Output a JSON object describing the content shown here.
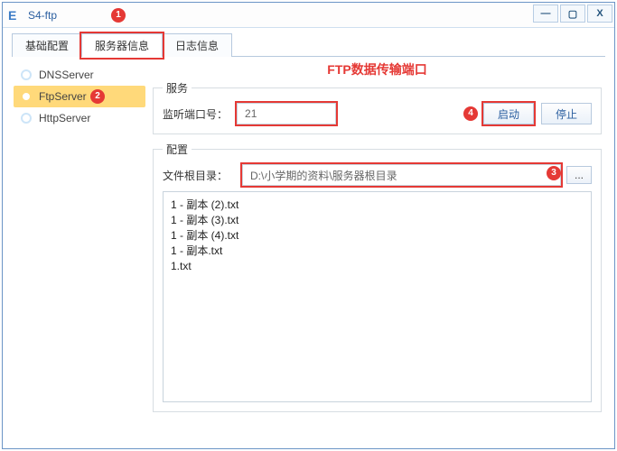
{
  "window": {
    "title": "S4-ftp"
  },
  "tabs": [
    "基础配置",
    "服务器信息",
    "日志信息"
  ],
  "sidebar": {
    "items": [
      {
        "label": "DNSServer"
      },
      {
        "label": "FtpServer"
      },
      {
        "label": "HttpServer"
      }
    ]
  },
  "heading": "FTP数据传输端口",
  "service": {
    "legend": "服务",
    "port_label": "监听端口号：",
    "port_value": "21",
    "start_label": "启动",
    "stop_label": "停止"
  },
  "config": {
    "legend": "配置",
    "root_label": "文件根目录：",
    "root_value": "D:\\小学期的资料\\服务器根目录",
    "browse": "...",
    "files": [
      "1 - 副本 (2).txt",
      "1 - 副本 (3).txt",
      "1 - 副本 (4).txt",
      "1 - 副本.txt",
      "1.txt"
    ]
  },
  "callouts": [
    "1",
    "2",
    "3",
    "4"
  ]
}
